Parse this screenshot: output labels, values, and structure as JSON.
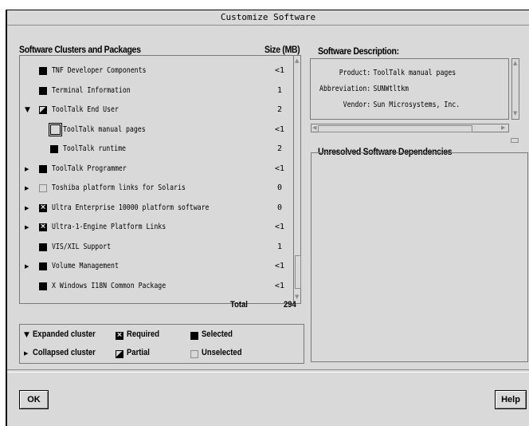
{
  "window": {
    "title": "Customize Software"
  },
  "list": {
    "header": "Software Clusters and Packages",
    "size_header": "Size (MB)",
    "items": [
      {
        "name": "TNF Developer Components",
        "size": "<1",
        "state": "selected",
        "expander": ""
      },
      {
        "name": "Terminal Information",
        "size": "1",
        "state": "selected",
        "expander": ""
      },
      {
        "name": "ToolTalk End User",
        "size": "2",
        "state": "partial",
        "expander": "expanded"
      },
      {
        "name": "ToolTalk manual pages",
        "size": "<1",
        "state": "unselected",
        "expander": ""
      },
      {
        "name": "ToolTalk runtime",
        "size": "2",
        "state": "selected",
        "expander": ""
      },
      {
        "name": "ToolTalk Programmer",
        "size": "<1",
        "state": "selected",
        "expander": "collapsed"
      },
      {
        "name": "Toshiba platform links for Solaris",
        "size": "0",
        "state": "unselected",
        "expander": "collapsed"
      },
      {
        "name": "Ultra Enterprise 10000 platform software",
        "size": "0",
        "state": "required",
        "expander": "collapsed"
      },
      {
        "name": "Ultra-1-Engine Platform Links",
        "size": "<1",
        "state": "required",
        "expander": "collapsed"
      },
      {
        "name": "VIS/XIL Support",
        "size": "1",
        "state": "selected",
        "expander": ""
      },
      {
        "name": "Volume Management",
        "size": "<1",
        "state": "selected",
        "expander": "collapsed"
      },
      {
        "name": "X Windows I18N Common Package",
        "size": "<1",
        "state": "selected",
        "expander": ""
      }
    ],
    "total_label": "Total",
    "total_value": "294"
  },
  "legend": {
    "expanded": "Expanded cluster",
    "collapsed": "Collapsed cluster",
    "required": "Required",
    "partial": "Partial",
    "selected": "Selected",
    "unselected": "Unselected"
  },
  "description": {
    "header": "Software Description:",
    "lines": [
      {
        "label": "Product:",
        "value": "ToolTalk manual pages"
      },
      {
        "label": "Abbreviation:",
        "value": "SUNWtltkm"
      },
      {
        "label": "Vendor:",
        "value": "Sun Microsystems, Inc."
      }
    ]
  },
  "dependencies": {
    "header": "Unresolved Software Dependencies"
  },
  "buttons": {
    "ok": "OK",
    "help": "Help"
  },
  "icons": {
    "expanded": "triangle-down-icon",
    "collapsed": "triangle-right-icon",
    "required": "x-box-icon",
    "partial": "half-box-icon",
    "selected": "filled-box-icon",
    "unselected": "empty-box-icon"
  }
}
